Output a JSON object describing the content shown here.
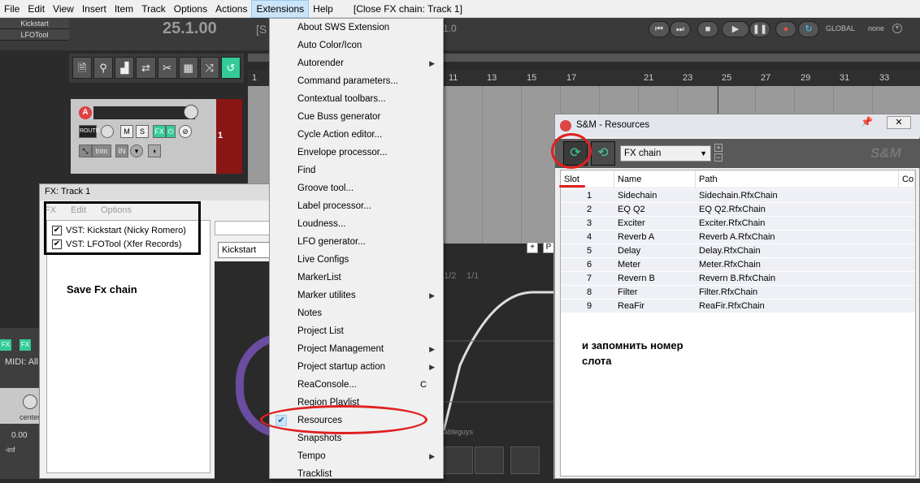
{
  "menubar": {
    "items": [
      "File",
      "Edit",
      "View",
      "Insert",
      "Item",
      "Track",
      "Options",
      "Actions",
      "Extensions",
      "Help"
    ],
    "active": "Extensions",
    "title": "[Close FX chain: Track 1]"
  },
  "tracks": [
    "Kickstart",
    "LFOTool"
  ],
  "transport": {
    "time": "25.1.00",
    "time2": "[S",
    "time3": "1.0",
    "global": "GLOBAL",
    "none": "none"
  },
  "ruler": [
    "1",
    "11",
    "13",
    "15",
    "17",
    "21",
    "23",
    "25",
    "27",
    "29",
    "31",
    "33"
  ],
  "track": {
    "rec_label": "A",
    "route": "ROUTE",
    "mute": "M",
    "solo": "S",
    "fx": "FX",
    "trim": "trim",
    "in": "IN",
    "number": "1"
  },
  "mixer": {
    "fx1": "FX",
    "fx2": "FX",
    "midi": "MIDI: All",
    "center": "center",
    "db": "0.00",
    "inf": "-inf"
  },
  "fx_window": {
    "title": "FX: Track 1",
    "menu": [
      "FX",
      "Edit",
      "Options"
    ],
    "plugins": [
      {
        "name": "VST: Kickstart (Nicky Romero)",
        "checked": true
      },
      {
        "name": "VST: LFOTool (Xfer Records)",
        "checked": true
      }
    ],
    "note": "Save Fx chain",
    "preset_select": "Kickstart",
    "plus_btn": "+",
    "p_btn": "P",
    "graph_label1": "1/2",
    "graph_label2": "1/1",
    "logo": "ableguys"
  },
  "ext_menu": {
    "items": [
      {
        "label": "About SWS Extension",
        "submenu": false
      },
      {
        "label": "Auto Color/Icon",
        "submenu": false
      },
      {
        "label": "Autorender",
        "submenu": true
      },
      {
        "label": "Command parameters...",
        "submenu": false
      },
      {
        "label": "Contextual toolbars...",
        "submenu": false
      },
      {
        "label": "Cue Buss generator",
        "submenu": false
      },
      {
        "label": "Cycle Action editor...",
        "submenu": false
      },
      {
        "label": "Envelope processor...",
        "submenu": false
      },
      {
        "label": "Find",
        "submenu": false
      },
      {
        "label": "Groove tool...",
        "submenu": false
      },
      {
        "label": "Label processor...",
        "submenu": false
      },
      {
        "label": "Loudness...",
        "submenu": false
      },
      {
        "label": "LFO generator...",
        "submenu": false
      },
      {
        "label": "Live Configs",
        "submenu": false
      },
      {
        "label": "MarkerList",
        "submenu": false
      },
      {
        "label": "Marker utilites",
        "submenu": true
      },
      {
        "label": "Notes",
        "submenu": false
      },
      {
        "label": "Project List",
        "submenu": false
      },
      {
        "label": "Project Management",
        "submenu": true
      },
      {
        "label": "Project startup action",
        "submenu": true
      },
      {
        "label": "ReaConsole...",
        "submenu": false,
        "accel": "C"
      },
      {
        "label": "Region Playlist",
        "submenu": false
      },
      {
        "label": "Resources",
        "submenu": false,
        "checked": true
      },
      {
        "label": "Snapshots",
        "submenu": false
      },
      {
        "label": "Tempo",
        "submenu": true
      },
      {
        "label": "Tracklist",
        "submenu": false
      }
    ]
  },
  "sm_window": {
    "title": "S&M - Resources",
    "close": "✕",
    "type": "FX chain",
    "brand": "S&M",
    "columns": [
      "Slot",
      "Name",
      "Path",
      "Co"
    ],
    "rows": [
      {
        "slot": "1",
        "name": "Sidechain",
        "path": "Sidechain.RfxChain"
      },
      {
        "slot": "2",
        "name": "EQ Q2",
        "path": "EQ Q2.RfxChain"
      },
      {
        "slot": "3",
        "name": "Exciter",
        "path": "Exciter.RfxChain"
      },
      {
        "slot": "4",
        "name": "Reverb A",
        "path": "Reverb A.RfxChain"
      },
      {
        "slot": "5",
        "name": "Delay",
        "path": "Delay.RfxChain"
      },
      {
        "slot": "6",
        "name": "Meter",
        "path": "Meter.RfxChain"
      },
      {
        "slot": "7",
        "name": "Revern B",
        "path": "Revern B.RfxChain"
      },
      {
        "slot": "8",
        "name": "Filter",
        "path": "Filter.RfxChain"
      },
      {
        "slot": "9",
        "name": "ReaFir",
        "path": "ReaFir.RfxChain"
      }
    ],
    "annotation": "и запомнить номер слота"
  },
  "colors": {
    "annotation_red": "#e02020",
    "accent_green": "#33cc99",
    "menu_highlight": "#cce4f7"
  }
}
